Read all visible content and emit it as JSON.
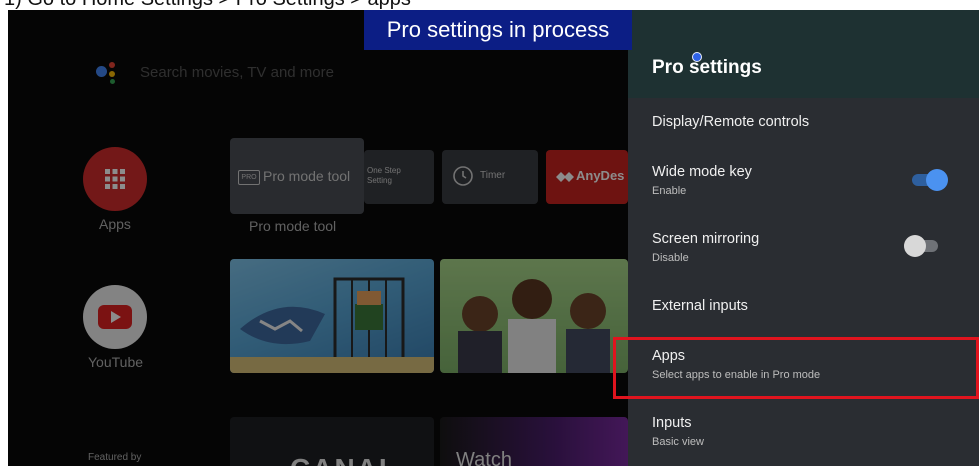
{
  "caption": "1)   Go to Home Settings > Pro Settings > apps",
  "banner": "Pro settings in process",
  "home": {
    "search_placeholder": "Search movies, TV and more",
    "apps_label": "Apps",
    "youtube_label": "YouTube",
    "featured_label": "Featured by",
    "tiles": {
      "pro_mode_tool": "Pro mode tool",
      "pro_badge": "PRO",
      "pro_mode_tool_caption": "Pro mode tool",
      "one_step_setting": "One Step Setting",
      "timer": "Timer",
      "anydesk": "AnyDes",
      "canal": "CANAL",
      "watch": "Watch"
    }
  },
  "panel": {
    "title": "Pro settings",
    "rows": [
      {
        "title": "Display/Remote controls",
        "sub": ""
      },
      {
        "title": "Wide mode key",
        "sub": "Enable"
      },
      {
        "title": "Screen mirroring",
        "sub": "Disable"
      },
      {
        "title": "External inputs",
        "sub": ""
      },
      {
        "title": "Apps",
        "sub": "Select apps to enable in Pro mode"
      },
      {
        "title": "Inputs",
        "sub": "Basic view"
      }
    ],
    "colors": {
      "toggle_on": "#4b92f0",
      "toggle_off": "#d8d8d8",
      "highlight": "#e0141e",
      "banner": "#0c1e85"
    }
  }
}
